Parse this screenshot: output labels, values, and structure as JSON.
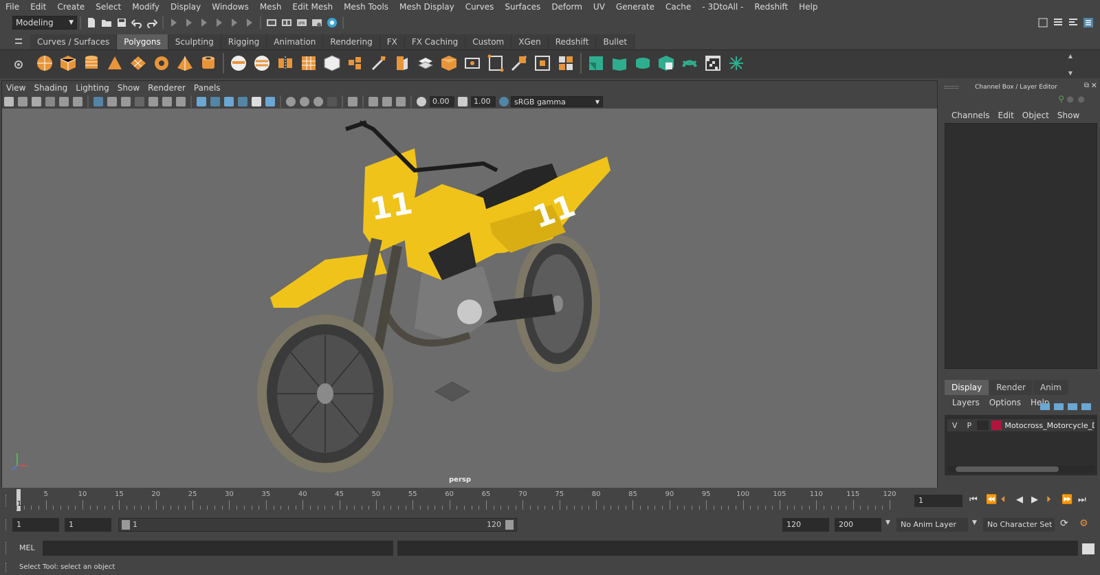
{
  "menubar": {
    "items": [
      "File",
      "Edit",
      "Create",
      "Select",
      "Modify",
      "Display",
      "Windows",
      "Mesh",
      "Edit Mesh",
      "Mesh Tools",
      "Mesh Display",
      "Curves",
      "Surfaces",
      "Deform",
      "UV",
      "Generate",
      "Cache",
      "- 3DtoAll -",
      "Redshift",
      "Help"
    ]
  },
  "statusline": {
    "mode": "Modeling"
  },
  "shelf": {
    "tabs": [
      "Curves / Surfaces",
      "Polygons",
      "Sculpting",
      "Rigging",
      "Animation",
      "Rendering",
      "FX",
      "FX Caching",
      "Custom",
      "XGen",
      "Redshift",
      "Bullet"
    ],
    "active_tab": "Polygons"
  },
  "viewport": {
    "menu": [
      "View",
      "Shading",
      "Lighting",
      "Show",
      "Renderer",
      "Panels"
    ],
    "exposure": "0.00",
    "gamma": "1.00",
    "colorspace": "sRGB gamma",
    "camera": "persp"
  },
  "channelbox": {
    "title": "Channel Box / Layer Editor",
    "menu": [
      "Channels",
      "Edit",
      "Object",
      "Show"
    ],
    "tabs": [
      "Display",
      "Render",
      "Anim"
    ],
    "active_tab": "Display",
    "layer_menu": [
      "Layers",
      "Options",
      "Help"
    ],
    "layer": {
      "v": "V",
      "p": "P",
      "name": "Motocross_Motorcycle_D",
      "color": "#b0163c"
    }
  },
  "timeline": {
    "labels": [
      "5",
      "10",
      "15",
      "20",
      "25",
      "30",
      "35",
      "40",
      "45",
      "50",
      "55",
      "60",
      "65",
      "70",
      "75",
      "80",
      "85",
      "90",
      "95",
      "100",
      "105",
      "110",
      "115",
      "120"
    ],
    "start_marker": "1",
    "current_frame": "1"
  },
  "range": {
    "start": "1",
    "anim_start": "1",
    "slider_start": "1",
    "slider_end": "120",
    "anim_end": "120",
    "end": "200",
    "anim_layer": "No Anim Layer",
    "character_set": "No Character Set"
  },
  "cmdline": {
    "label": "MEL"
  },
  "helpline": {
    "text": "Select Tool: select an object"
  },
  "colors": {
    "accent": "#5285a6",
    "bike_yellow": "#f0c31a",
    "layer_red": "#b0163c"
  }
}
